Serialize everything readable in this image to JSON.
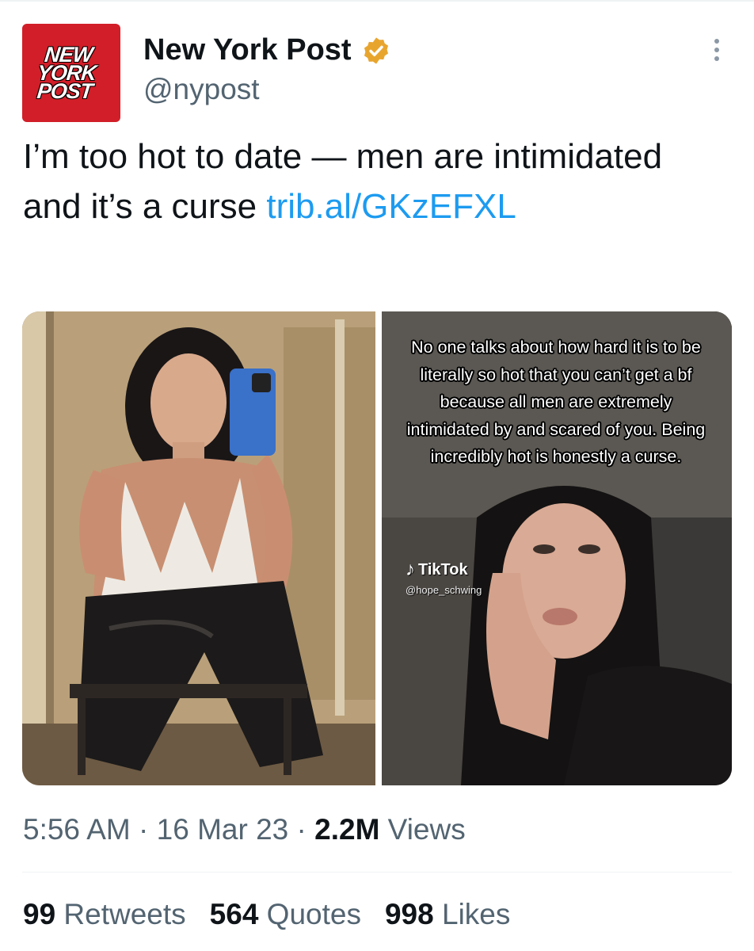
{
  "account": {
    "display_name": "New York Post",
    "handle": "@nypost",
    "avatar_lines": [
      "NEW",
      "YORK",
      "POST"
    ],
    "verified_color": "#e8a52e"
  },
  "tweet": {
    "text": "I’m too hot to date — men are intimidated and it’s a curse ",
    "link": "trib.al/GKzEFXL",
    "link_color": "#1d9bf0"
  },
  "media": {
    "overlay_caption": "No one talks about how hard it is to be literally so hot that you can’t get a bf because all men are extremely intimidated by and scared of you. Being incredibly hot is honestly a curse.",
    "tiktok_label": "TikTok",
    "tiktok_handle": "@hope_schwing"
  },
  "meta": {
    "time": "5:56 AM",
    "sep1": " · ",
    "date": "16 Mar 23",
    "sep2": " · ",
    "views_count": "2.2M",
    "views_label": " Views"
  },
  "stats": {
    "retweets_count": "99",
    "retweets_label": " Retweets",
    "quotes_count": "564",
    "quotes_label": " Quotes",
    "likes_count": "998",
    "likes_label": " Likes"
  },
  "icons": {
    "more": "more-options-icon",
    "verified": "verified-badge-icon",
    "tiktok": "tiktok-icon"
  }
}
